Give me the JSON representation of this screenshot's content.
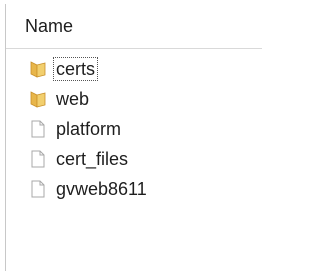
{
  "columns": {
    "name_header": "Name"
  },
  "items": [
    {
      "label": "certs",
      "icon": "folder-icon",
      "focused": true
    },
    {
      "label": "web",
      "icon": "folder-icon",
      "focused": false
    },
    {
      "label": "platform",
      "icon": "file-icon",
      "focused": false
    },
    {
      "label": "cert_files",
      "icon": "file-icon",
      "focused": false
    },
    {
      "label": "gvweb8611",
      "icon": "file-icon",
      "focused": false
    }
  ],
  "colors": {
    "folder": "#e8b64a",
    "folder_shadow": "#c9902a",
    "file_border": "#a8a8a8"
  }
}
